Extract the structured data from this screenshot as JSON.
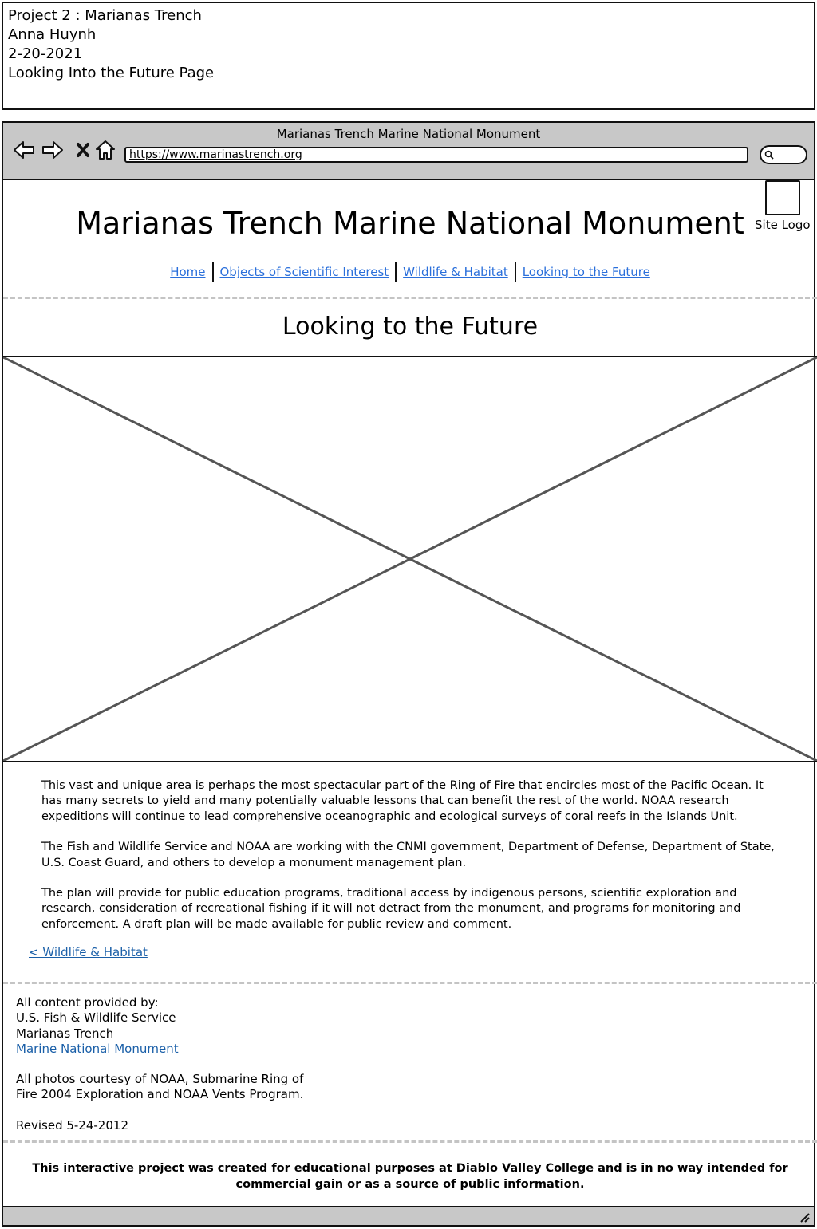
{
  "annotation": {
    "line1": "Project 2 : Marianas Trench",
    "line2": "Anna Huynh",
    "line3": "2-20-2021",
    "line4": "Looking Into the Future Page"
  },
  "browser": {
    "window_title": "Marianas Trench Marine National Monument",
    "url": "https://www.marinastrench.org",
    "icons": [
      "back-arrow-icon",
      "forward-arrow-icon",
      "close-icon",
      "home-icon",
      "search-icon"
    ]
  },
  "site": {
    "title": "Marianas Trench Marine National Monument",
    "logo_label": "Site Logo"
  },
  "nav": {
    "items": [
      {
        "label": "Home"
      },
      {
        "label": "Objects of Scientific Interest"
      },
      {
        "label": "Wildlife & Habitat"
      },
      {
        "label": "Looking to the Future"
      }
    ]
  },
  "page": {
    "heading": "Looking to the Future",
    "paragraphs": [
      "This vast and unique area is perhaps the most spectacular part of the Ring of Fire that encircles most of the Pacific Ocean. It has many secrets to yield and many potentially valuable lessons that can benefit the rest of the world. NOAA research expeditions will continue to lead comprehensive oceanographic and ecological surveys of coral reefs in the Islands Unit.",
      "The Fish and Wildlife Service and NOAA are working with the CNMI government, Department of Defense, Department of State, U.S. Coast Guard, and others to develop a monument management plan.",
      "The plan will provide for public education programs, traditional access by indigenous persons, scientific exploration and research, consideration of recreational fishing if it will not detract from the monument, and programs for monitoring and enforcement. A draft plan will be made available for public review and comment."
    ],
    "back_link": "< Wildlife & Habitat"
  },
  "footer": {
    "credit_heading": "All content provided by:",
    "credit_org": "U.S. Fish & Wildlife Service",
    "credit_place": "Marianas Trench",
    "credit_link": "Marine National Monument",
    "photos_line1": "All photos courtesy of NOAA, Submarine Ring of",
    "photos_line2": "Fire 2004 Exploration and NOAA Vents Program.",
    "revised": "Revised 5-24-2012",
    "disclaimer": "This interactive project was created for educational purposes at Diablo Valley College and is in no way intended for commercial gain or as a source of public information."
  },
  "colors": {
    "toolbar": "#c8c8c8",
    "nav_link": "#2a6fdb",
    "footer_link": "#1a5fa8",
    "divider": "#c4c4c4"
  }
}
